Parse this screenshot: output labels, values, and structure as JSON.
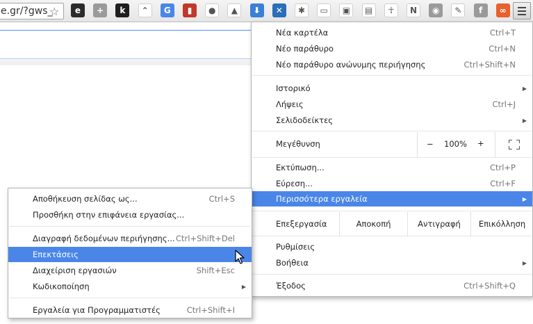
{
  "omnibox": {
    "url_text": "e.gr/?gws_"
  },
  "icons": {
    "star": "star-icon",
    "menu": "hamburger-menu-icon"
  },
  "extensions": [
    {
      "name": "ext-e-icon",
      "glyph": "e",
      "bg": "#2b2b2b"
    },
    {
      "name": "ext-plus-icon",
      "glyph": "+",
      "bg": "#9a9a9a"
    },
    {
      "name": "ext-k-icon",
      "glyph": "k",
      "bg": "#1f1f1f"
    },
    {
      "name": "ext-wave-icon",
      "glyph": "⌃",
      "bg": "#ffffff"
    },
    {
      "name": "ext-translate-icon",
      "glyph": "G",
      "bg": "#4a86e8"
    },
    {
      "name": "ext-book-icon",
      "glyph": "▮",
      "bg": "#c0392b"
    },
    {
      "name": "ext-leaf-icon",
      "glyph": "●",
      "bg": "#ffffff"
    },
    {
      "name": "ext-drive-icon",
      "glyph": "▲",
      "bg": "#ffffff"
    },
    {
      "name": "ext-download-icon",
      "glyph": "⬇",
      "bg": "#3b7fd6"
    },
    {
      "name": "ext-x-icon",
      "glyph": "✕",
      "bg": "#2a6fb8"
    },
    {
      "name": "ext-pinwheel-icon",
      "glyph": "✱",
      "bg": "#ffffff"
    },
    {
      "name": "ext-page-icon",
      "glyph": "▭",
      "bg": "#ffffff"
    },
    {
      "name": "ext-box-icon",
      "glyph": "▣",
      "bg": "#ffffff"
    },
    {
      "name": "ext-save-icon",
      "glyph": "▤",
      "bg": "#ffffff"
    },
    {
      "name": "ext-ankh-icon",
      "glyph": "☥",
      "bg": "#ffffff"
    },
    {
      "name": "ext-n-icon",
      "glyph": "N",
      "bg": "#ffffff"
    },
    {
      "name": "ext-rss-icon",
      "glyph": "◉",
      "bg": "#9a9a9a"
    },
    {
      "name": "ext-pen-icon",
      "glyph": "✎",
      "bg": "#ffffff"
    },
    {
      "name": "ext-f-icon",
      "glyph": "f",
      "bg": "#9a9a9a"
    },
    {
      "name": "ext-infinity-icon",
      "glyph": "∞",
      "bg": "#e8602c"
    }
  ],
  "main_menu": {
    "new_tab": {
      "label": "Νέα καρτέλα",
      "shortcut": "Ctrl+T"
    },
    "new_window": {
      "label": "Νέο παράθυρο",
      "shortcut": "Ctrl+N"
    },
    "incognito": {
      "label": "Νέο παράθυρο ανώνυμης περιήγησης",
      "shortcut": "Ctrl+Shift+N"
    },
    "history": {
      "label": "Ιστορικό"
    },
    "downloads": {
      "label": "Λήψεις",
      "shortcut": "Ctrl+J"
    },
    "bookmarks": {
      "label": "Σελιδοδείκτες"
    },
    "zoom": {
      "label": "Μεγέθυνση",
      "minus": "−",
      "value": "100%",
      "plus": "+"
    },
    "print": {
      "label": "Εκτύπωση...",
      "shortcut": "Ctrl+P"
    },
    "find": {
      "label": "Εύρεση...",
      "shortcut": "Ctrl+F"
    },
    "more_tools": {
      "label": "Περισσότερα εργαλεία"
    },
    "edit": {
      "label": "Επεξεργασία",
      "cut": "Αποκοπή",
      "copy": "Αντιγραφή",
      "paste": "Επικόλληση"
    },
    "settings": {
      "label": "Ρυθμίσεις"
    },
    "help": {
      "label": "Βοήθεια"
    },
    "exit": {
      "label": "Έξοδος",
      "shortcut": "Ctrl+Shift+Q"
    }
  },
  "submenu": {
    "save_page": {
      "label": "Αποθήκευση σελίδας ως...",
      "shortcut": "Ctrl+S"
    },
    "add_to_desktop": {
      "label": "Προσθήκη στην επιφάνεια εργασίας..."
    },
    "clear_data": {
      "label": "Διαγραφή δεδομένων περιήγησης...",
      "shortcut": "Ctrl+Shift+Del"
    },
    "extensions": {
      "label": "Επεκτάσεις"
    },
    "task_manager": {
      "label": "Διαχείριση εργασιών",
      "shortcut": "Shift+Esc"
    },
    "encoding": {
      "label": "Κωδικοποίηση"
    },
    "dev_tools": {
      "label": "Εργαλεία για Προγραμματιστές",
      "shortcut": "Ctrl+Shift+I"
    }
  },
  "colors": {
    "highlight": "#4a86e8",
    "omnibox_focus": "#4d90fe"
  }
}
